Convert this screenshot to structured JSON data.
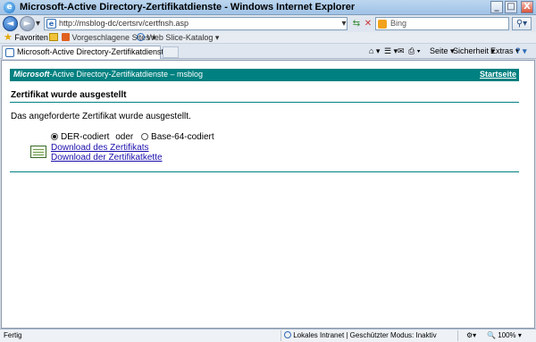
{
  "window": {
    "title": "Microsoft-Active Directory-Zertifikatdienste - Windows Internet Explorer",
    "minimize": "_",
    "maximize": "□",
    "close": "X"
  },
  "address": {
    "url": "http://msblog-dc/certsrv/certfnsh.asp",
    "search_placeholder": "Bing"
  },
  "favorites": {
    "favorites_label": "Favoriten",
    "suggested_label": "Vorgeschlagene Sites ▾",
    "webslice_label": "Web Slice-Katalog ▾"
  },
  "tab": {
    "label": "Microsoft-Active Directory-Zertifikatdienste"
  },
  "commandbar": {
    "page": "Seite ▾",
    "safety": "Sicherheit ▾",
    "tools": "Extras ▾"
  },
  "page": {
    "brand_italic": "Microsoft",
    "brand_rest": "-Active Directory-Zertifikatdienste  –  msblog",
    "home_link": "Startseite",
    "heading": "Zertifikat wurde ausgestellt",
    "message": "Das angeforderte Zertifikat wurde ausgestellt.",
    "der_label": "DER-codiert",
    "or_label": "oder",
    "base64_label": "Base-64-codiert",
    "selected_encoding": "DER-codiert",
    "download_cert": "Download des Zertifikats",
    "download_chain": "Download der Zertifikatkette"
  },
  "statusbar": {
    "status": "Fertig",
    "zone": "Lokales Intranet | Geschützter Modus: Inaktiv",
    "zoom": "100%"
  },
  "colors": {
    "banner": "#008080",
    "link": "#1a0dab"
  }
}
